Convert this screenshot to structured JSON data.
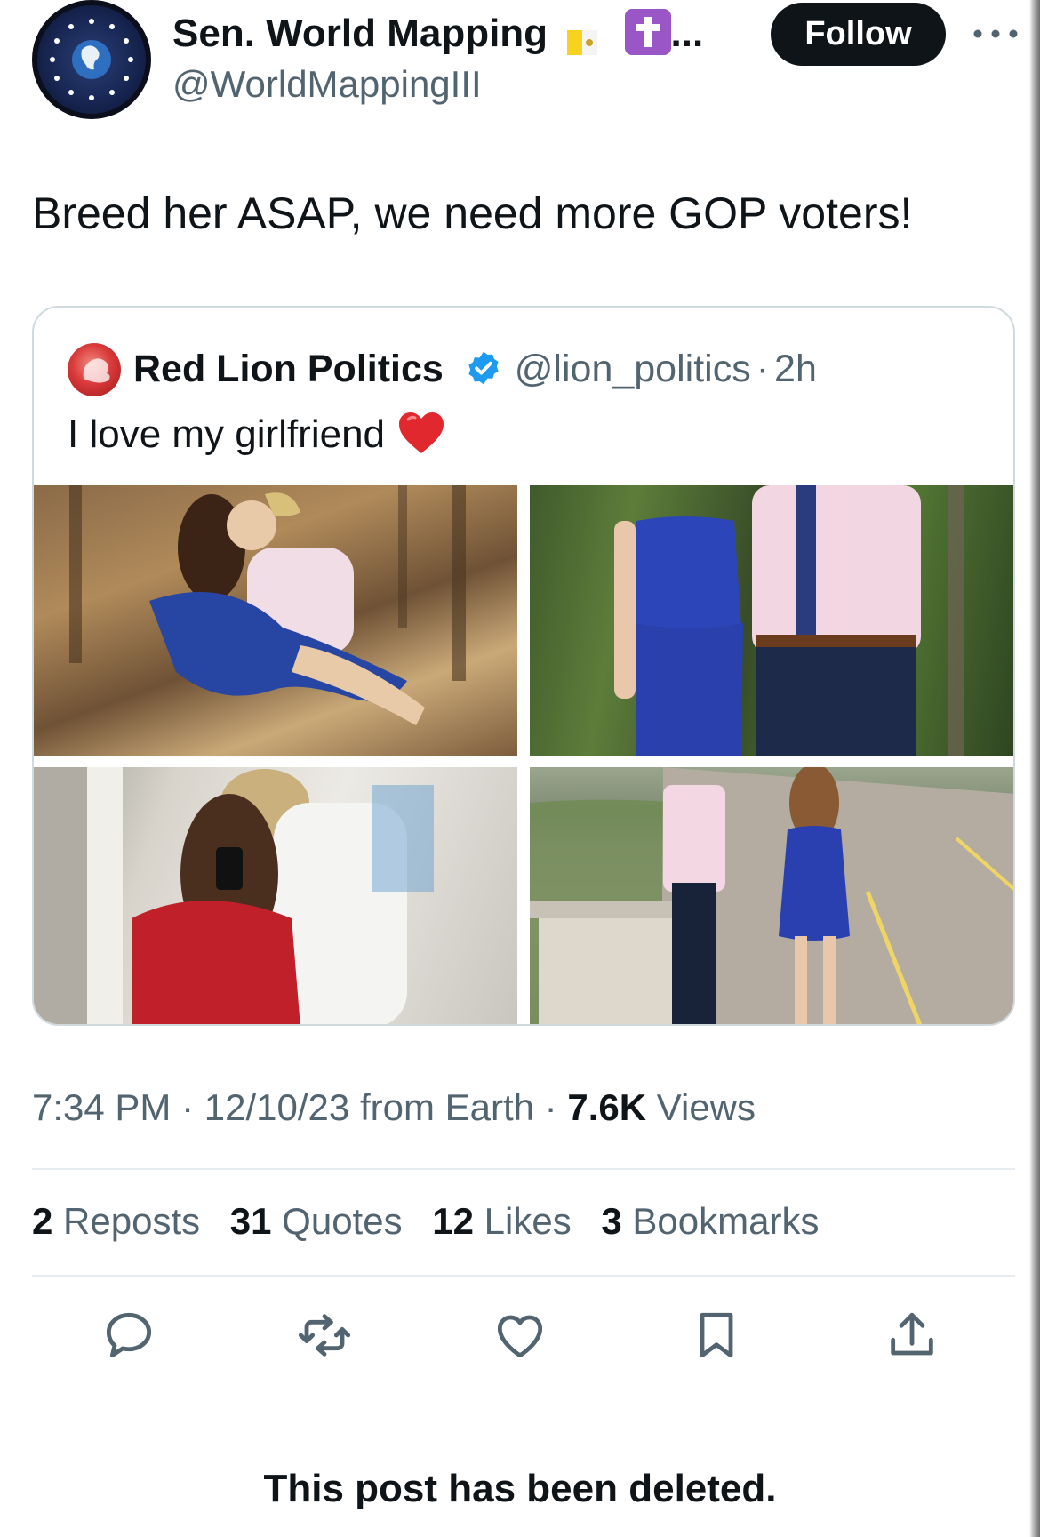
{
  "author": {
    "display_name": "Sen. World Mapping",
    "name_truncation": "...",
    "handle": "@WorldMappingIII",
    "avatar_icon": "globe-stars-icon",
    "badges": [
      "vatican-flag-icon",
      "latin-cross-icon"
    ]
  },
  "follow_label": "Follow",
  "post_text": "Breed her ASAP, we need more GOP voters!",
  "quote": {
    "display_name": "Red Lion Politics",
    "verified": true,
    "handle": "@lion_politics",
    "separator": "·",
    "age": "2h",
    "text": "I love my girlfriend",
    "emoji": "red-heart-icon",
    "photos": [
      "photo-couple-kiss-forest",
      "photo-couple-standing-woods",
      "photo-couple-mirror-selfie",
      "photo-couple-walking-road"
    ]
  },
  "meta": {
    "time": "7:34 PM",
    "sep1": "·",
    "date": "12/10/23",
    "source": "from Earth",
    "sep2": "·",
    "views_count": "7.6K",
    "views_label": "Views"
  },
  "stats": [
    {
      "count": "2",
      "label": "Reposts"
    },
    {
      "count": "31",
      "label": "Quotes"
    },
    {
      "count": "12",
      "label": "Likes"
    },
    {
      "count": "3",
      "label": "Bookmarks"
    }
  ],
  "actions": [
    "reply-icon",
    "repost-icon",
    "like-icon",
    "bookmark-icon",
    "share-icon"
  ],
  "deleted_notice": "This post has been deleted.",
  "colors": {
    "text": "#0f1419",
    "secondary": "#536471",
    "verified": "#1d9bf0",
    "border": "#cfd9de"
  }
}
